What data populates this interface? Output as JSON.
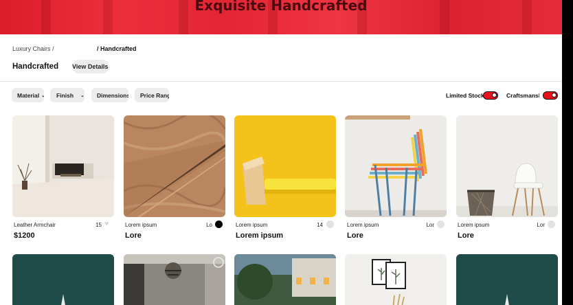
{
  "hero": {
    "title": "Exquisite Handcrafted"
  },
  "breadcrumb": {
    "root": "Luxury Chairs /",
    "current": "/ Handcrafted"
  },
  "header": {
    "title": "Handcrafted",
    "view_details": "View Details"
  },
  "filters": [
    {
      "label": "Material",
      "chevron": true
    },
    {
      "label": "Finish",
      "chevron": true
    },
    {
      "label": "Dimensions",
      "chevron": false
    },
    {
      "label": "Price Range",
      "chevron": false
    }
  ],
  "toggles": [
    {
      "label": "Limited Stock",
      "on": true
    },
    {
      "label": "Craftsmanship",
      "on": true
    }
  ],
  "products": [
    {
      "name": "Leather Armchair",
      "price": "$1200",
      "count": "15",
      "like_style": "heart",
      "image": "white-room"
    },
    {
      "name": "Lorem ipsum",
      "price": "Lore",
      "count": "Lo",
      "like_style": "dark",
      "image": "wood-panel"
    },
    {
      "name": "Lorem ipsum",
      "price": "Lorem ipsum",
      "count": "14",
      "like_style": "light",
      "image": "yellow-hammer"
    },
    {
      "name": "Lorem ipsum",
      "price": "Lore",
      "count": "Lor",
      "like_style": "light",
      "image": "stacked-chairs"
    },
    {
      "name": "Lorem ipsum",
      "price": "Lore",
      "count": "Lor",
      "like_style": "light",
      "image": "white-chair"
    }
  ],
  "row2_images": [
    "teal-boat",
    "chandelier-room",
    "house-garden",
    "framed-plants",
    "teal-boat"
  ],
  "colors": {
    "accent": "#e8121f",
    "hero": "#e42634"
  }
}
